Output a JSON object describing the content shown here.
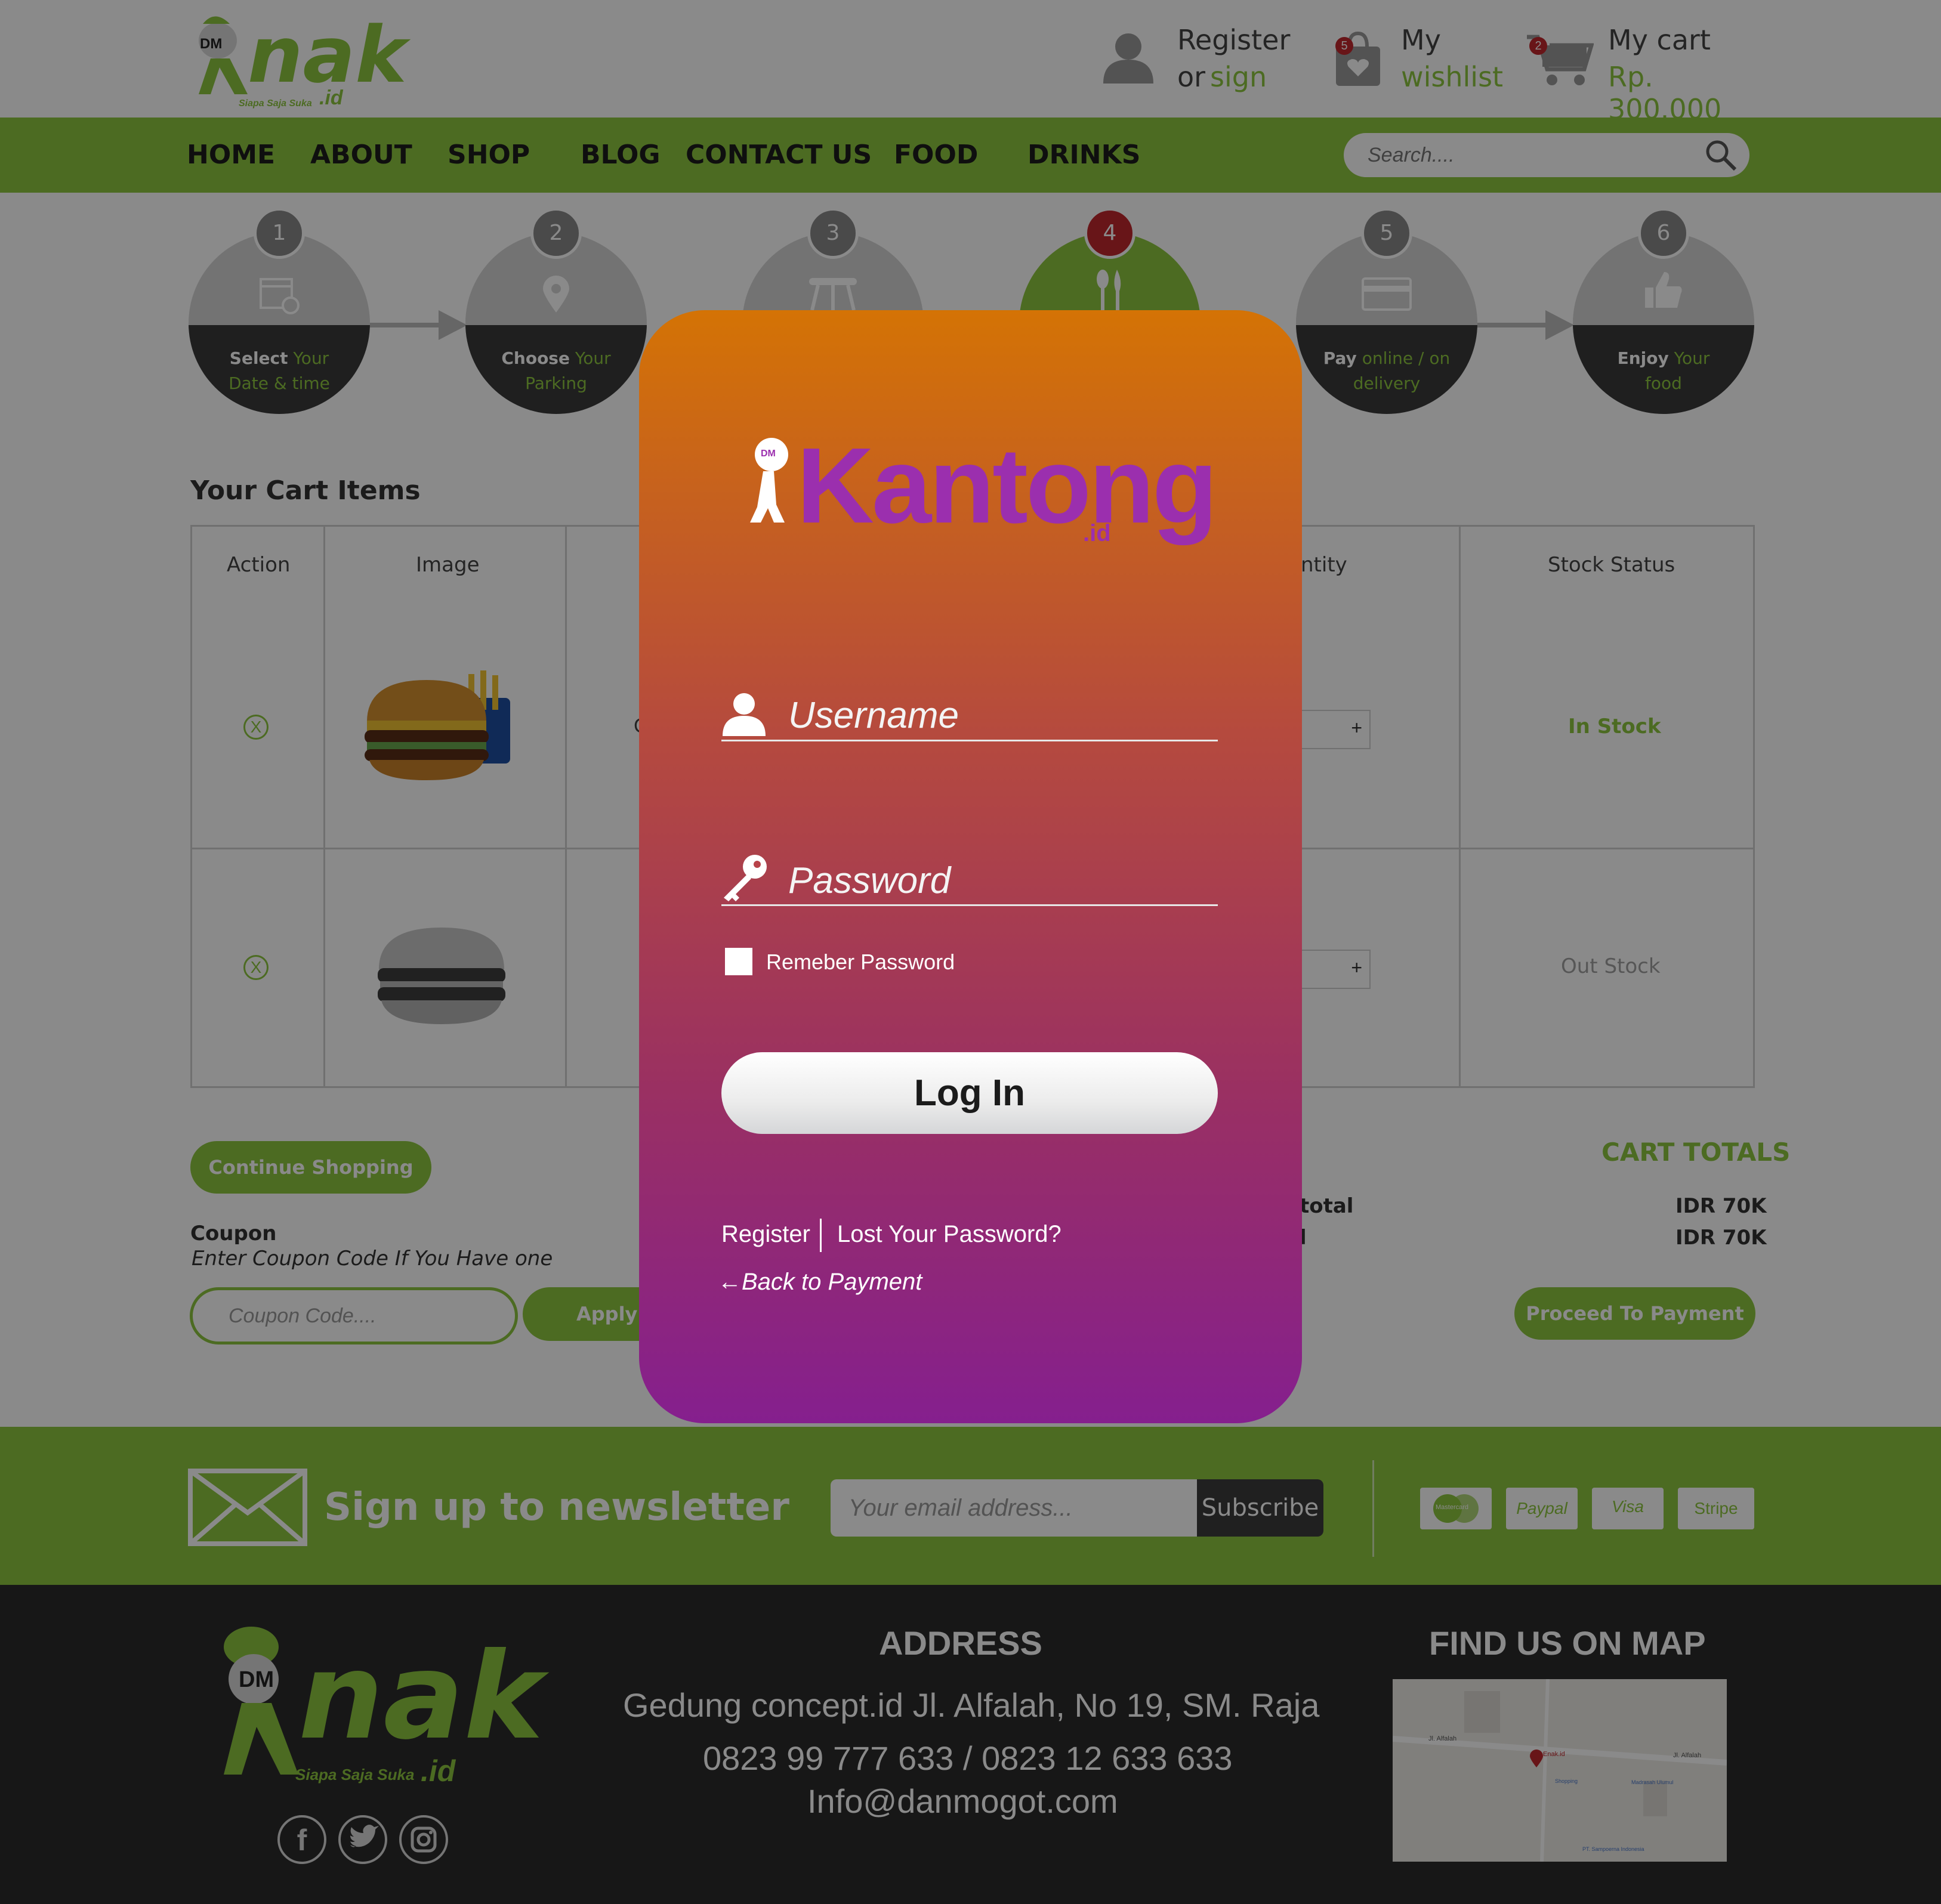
{
  "header": {
    "register_line1": "Register",
    "register_or": "or",
    "register_sign": "sign",
    "wishlist_line1": "My",
    "wishlist_line2": "wishlist",
    "wishlist_count": "5",
    "cart_line1": "My cart",
    "cart_total": "Rp. 300.000",
    "cart_count": "2",
    "logo_text": "nak",
    "logo_tagline": "Siapa Saja Suka",
    "logo_badge": "DM",
    "logo_tld": ".id"
  },
  "nav": {
    "items": [
      "HOME",
      "ABOUT",
      "SHOP",
      "BLOG",
      "CONTACT US",
      "FOOD",
      "DRINKS"
    ],
    "search_placeholder": "Search...."
  },
  "steps": [
    {
      "num": "1",
      "bold": "Select",
      "rest1": "Your",
      "line2": "Date & time"
    },
    {
      "num": "2",
      "bold": "Choose",
      "rest1": "Your",
      "line2": "Parking"
    },
    {
      "num": "3"
    },
    {
      "num": "4"
    },
    {
      "num": "5",
      "bold": "Pay",
      "rest1": "online / on",
      "line2": "delivery"
    },
    {
      "num": "6",
      "bold": "Enjoy",
      "rest1": "Your",
      "line2": "food"
    }
  ],
  "cart": {
    "title": "Your Cart Items",
    "headers": {
      "action": "Action",
      "image": "Image",
      "quantity_partial": "ntity",
      "stock": "Stock Status"
    },
    "rows": [
      {
        "stock": "In Stock",
        "plus": "+",
        "partial_cell": "C"
      },
      {
        "stock": "Out Stock",
        "plus": "+"
      }
    ],
    "remove_symbol": "X",
    "continue_label": "Continue Shopping",
    "coupon_label": "Coupon",
    "coupon_hint": "Enter Coupon Code If You Have one",
    "coupon_placeholder": "Coupon Code....",
    "apply_partial": "Apply C",
    "totals_title": "CART TOTALS",
    "subtotal_partial": "total",
    "total_partial": "l",
    "subtotal_value": "IDR 70K",
    "total_value": "IDR 70K",
    "proceed_label": "Proceed To Payment"
  },
  "newsletter": {
    "title": "Sign up to newsletter",
    "email_placeholder": "Your email address...",
    "subscribe_label": "Subscribe",
    "payments": [
      "Mastercard",
      "Paypal",
      "Visa",
      "Stripe"
    ]
  },
  "footer": {
    "address_title": "ADDRESS",
    "address_line": "Gedung concept.id Jl. Alfalah, No 19, SM. Raja",
    "phone_line": "0823 99 777 633 / 0823 12 633 633",
    "email_line": "Info@danmogot.com",
    "map_title": "FIND US ON MAP",
    "map_labels": {
      "street1": "Jl. Alfalah",
      "street2": "Jl. Alfalah",
      "poi1": "Enak.id",
      "poi2": "Shopping",
      "poi3": "Madrasah Ulumul",
      "poi4": "PT. Sampoerna Indonesia"
    }
  },
  "modal": {
    "brand": "Kantong",
    "brand_tld": ".id",
    "brand_badge": "DM",
    "username_placeholder": "Username",
    "password_placeholder": "Password",
    "remember_label": "Remeber Password",
    "login_label": "Log In",
    "register_link": "Register",
    "lost_password_link": "Lost Your Password?",
    "back_link": "←Back to Payment"
  },
  "colors": {
    "accent_green": "#8dc63f",
    "active_step_red": "#c1272d",
    "modal_top": "#d47305",
    "modal_bottom": "#851f8e",
    "brand_purple": "#9b2fae"
  }
}
